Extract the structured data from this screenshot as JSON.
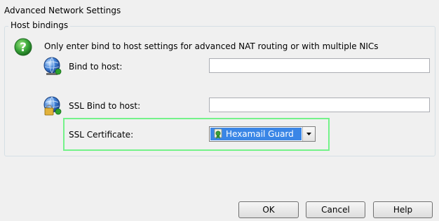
{
  "window": {
    "title": "Advanced Network Settings"
  },
  "host_bindings": {
    "legend": "Host bindings",
    "help_icon": "question-mark-icon",
    "hint": "Only enter bind to host settings for advanced NAT routing or with multiple NICs",
    "bind_to_host": {
      "label": "Bind to host:",
      "value": "",
      "icon": "globe-network-icon"
    },
    "ssl_bind_to_host": {
      "label": "SSL Bind to host:",
      "value": "",
      "icon": "globe-lock-icon"
    },
    "ssl_certificate": {
      "label": "SSL Certificate:",
      "selected": "Hexamail Guard",
      "item_icon": "certificate-icon",
      "highlight_color": "#74f28a"
    }
  },
  "buttons": {
    "ok": "OK",
    "cancel": "Cancel",
    "help": "Help"
  },
  "colors": {
    "selection": "#3a86e6",
    "help_icon": "#3aa63a"
  }
}
